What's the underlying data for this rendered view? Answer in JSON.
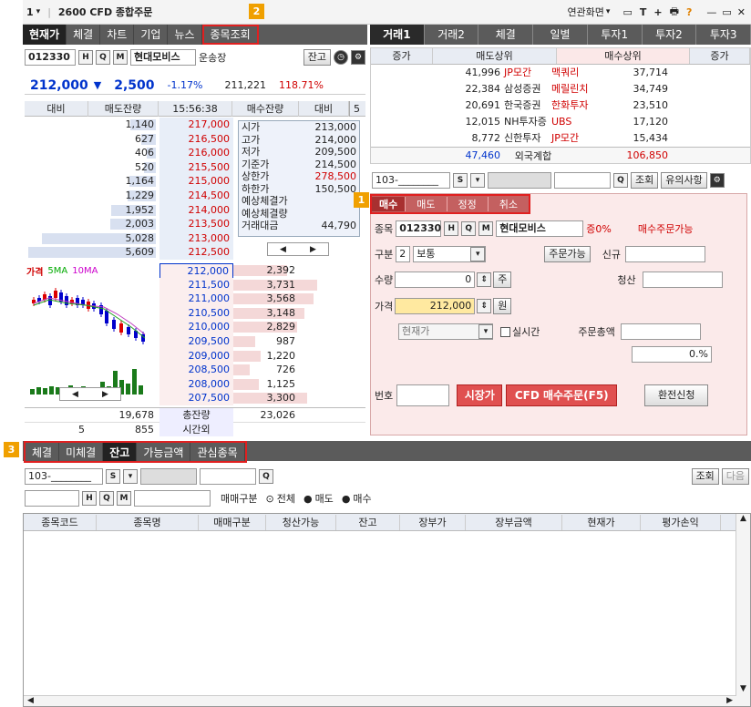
{
  "window": {
    "number": "1",
    "title": "2600 CFD 종합주문",
    "related": "연관화면"
  },
  "left_tabs": [
    "현재가",
    "체결",
    "차트",
    "기업",
    "뉴스",
    "종목조회"
  ],
  "stock": {
    "code": "012330",
    "name": "현대모비스",
    "note": "운송장",
    "btn_balance": "잔고"
  },
  "price": {
    "current": "212,000",
    "arrow": "▼",
    "change": "2,500",
    "pct": "-1.17%",
    "volume": "211,221",
    "ratio": "118.71%"
  },
  "orderbook": {
    "headers": [
      "대비",
      "매도잔량",
      "15:56:38",
      "매수잔량",
      "대비"
    ],
    "ask_qty": [
      "1,140",
      "627",
      "406",
      "520",
      "1,164",
      "1,229",
      "1,952",
      "2,003",
      "5,028",
      "5,609"
    ],
    "ask_prices": [
      "217,000",
      "216,500",
      "216,000",
      "215,500",
      "215,000",
      "214,500",
      "214,000",
      "213,500",
      "213,000",
      "212,500"
    ],
    "bid_prices": [
      "212,000",
      "211,500",
      "211,000",
      "210,500",
      "210,000",
      "209,500",
      "209,000",
      "208,500",
      "208,000",
      "207,500"
    ],
    "bid_qty": [
      "2,392",
      "3,731",
      "3,568",
      "3,148",
      "2,829",
      "987",
      "1,220",
      "726",
      "1,125",
      "3,300"
    ],
    "info_labels": [
      "시가",
      "고가",
      "저가",
      "기준가",
      "상한가",
      "하한가",
      "예상체결가",
      "예상체결량",
      "거래대금"
    ],
    "info_values": [
      "213,000",
      "214,000",
      "209,500",
      "214,500",
      "278,500",
      "150,500",
      "",
      "",
      "44,790"
    ],
    "total_ask": "19,678",
    "total_label": "총잔량",
    "total_bid": "23,026",
    "after_left": "5",
    "after_mid": "855",
    "after_label": "시간외"
  },
  "mini_chart": {
    "title": "가격",
    "ma5": "5MA",
    "ma10": "10MA"
  },
  "right_tabs": [
    "거래1",
    "거래2",
    "체결",
    "일별",
    "투자1",
    "투자2",
    "투자3"
  ],
  "broker": {
    "headers": [
      "증가",
      "매도상위",
      "매수상위",
      "증가"
    ],
    "rows": [
      [
        "41,996",
        "JP모간",
        "맥쿼리",
        "37,714"
      ],
      [
        "22,384",
        "삼성증권",
        "메릴린치",
        "34,749"
      ],
      [
        "20,691",
        "한국증권",
        "한화투자",
        "23,510"
      ],
      [
        "12,015",
        "NH투자증",
        "UBS",
        "17,120"
      ],
      [
        "8,772",
        "신한투자",
        "JP모간",
        "15,434"
      ]
    ],
    "foreign_sell": "47,460",
    "foreign_label": "외국계합",
    "foreign_buy": "106,850"
  },
  "order": {
    "account": "103-________",
    "btn_inquire": "조회",
    "btn_notice": "유의사항",
    "tabs": [
      "매수",
      "매도",
      "정정",
      "취소"
    ],
    "label_code": "종목",
    "code": "012330",
    "name": "현대모비스",
    "margin": "증0%",
    "status": "매수주문가능",
    "label_type": "구분",
    "type_num": "2",
    "type": "보통",
    "btn_possible": "주문가능",
    "label_new": "신규",
    "label_qty": "수량",
    "qty": "0",
    "unit_qty": "주",
    "label_settle": "청산",
    "label_price": "가격",
    "price": "212,000",
    "unit_price": "원",
    "price_type": "현재가",
    "realtime": "실시간",
    "label_total": "주문총액",
    "pct": "0.%",
    "label_no": "번호",
    "btn_market": "시장가",
    "btn_buy": "CFD 매수주문(F5)",
    "btn_exchange": "환전신청"
  },
  "badges": [
    "1",
    "2",
    "3"
  ],
  "bottom": {
    "tabs": [
      "체결",
      "미체결",
      "잔고",
      "가능금액",
      "관심종목"
    ],
    "account": "103-________",
    "btn_inquire": "조회",
    "btn_next": "다음",
    "trade_label": "매매구분",
    "radios": [
      "전체",
      "매도",
      "매수"
    ],
    "columns": [
      "종목코드",
      "종목명",
      "매매구분",
      "청산가능",
      "잔고",
      "장부가",
      "장부금액",
      "현재가",
      "평가손익"
    ]
  }
}
